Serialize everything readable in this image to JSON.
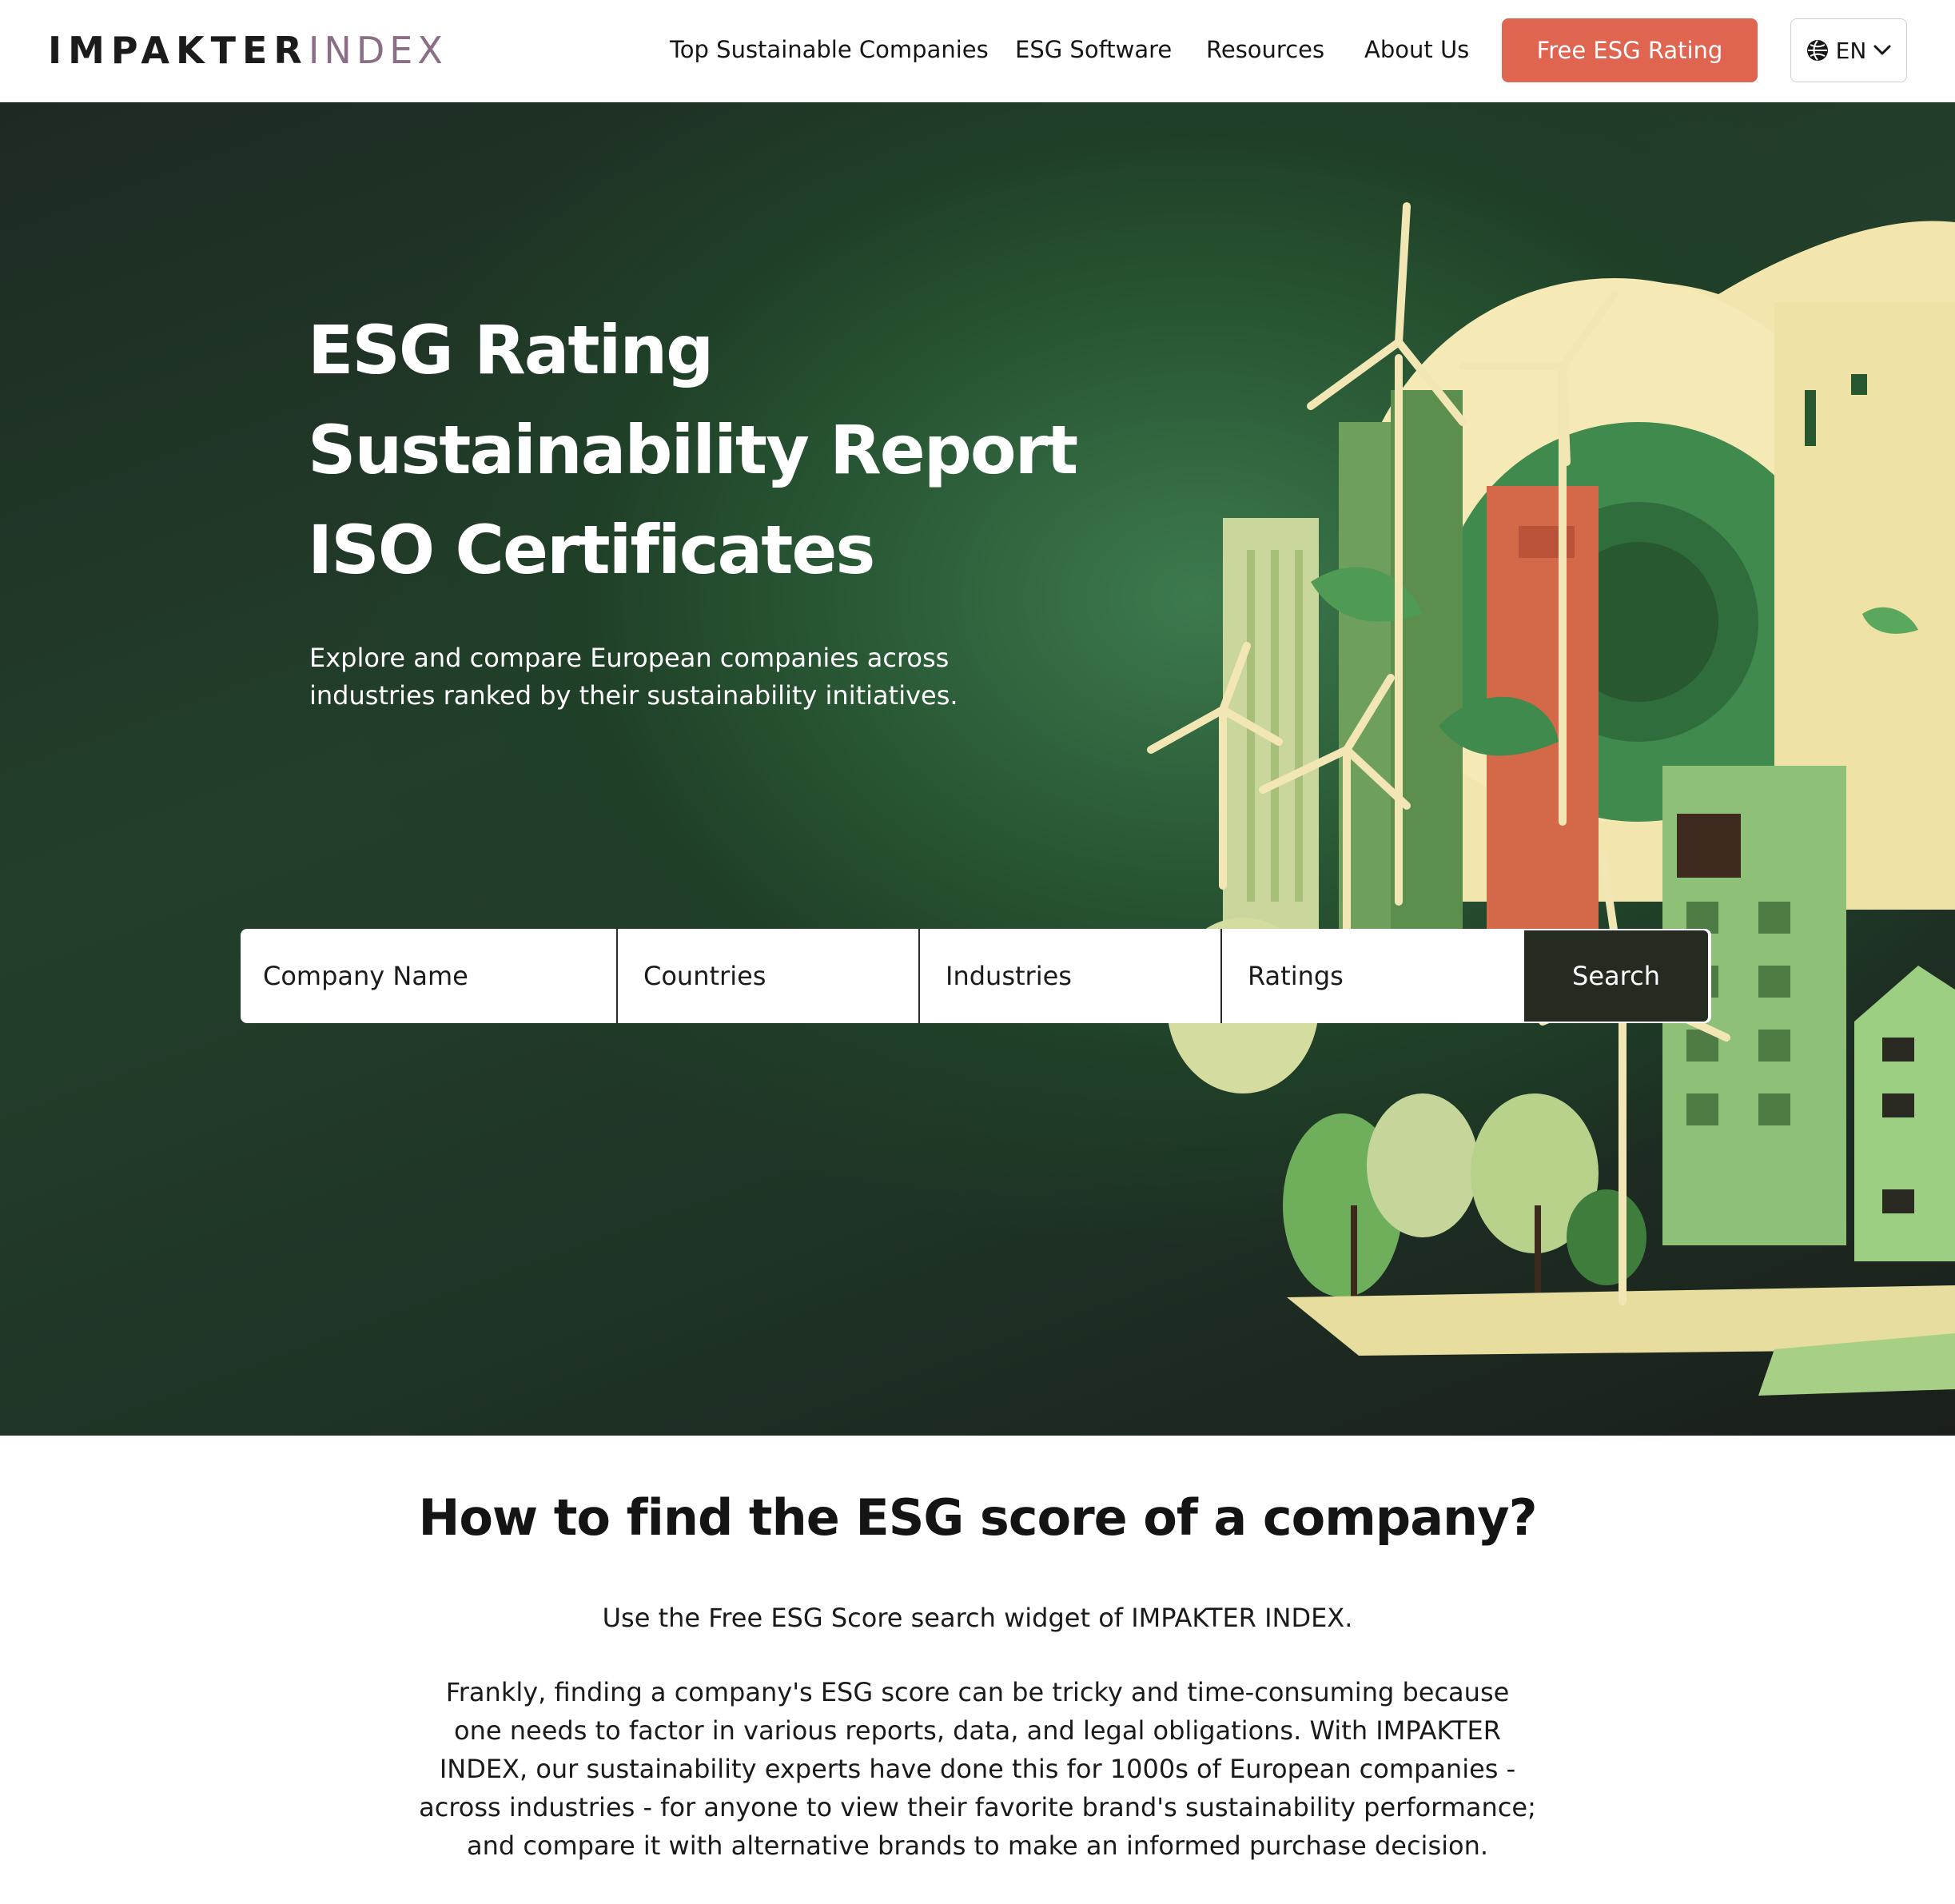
{
  "header": {
    "logo_primary": "IMPAKTER",
    "logo_secondary": "INDEX",
    "nav": [
      {
        "label": "Top Sustainable Companies"
      },
      {
        "label": "ESG Software"
      },
      {
        "label": "Resources"
      },
      {
        "label": "About Us"
      }
    ],
    "cta_label": "Free ESG Rating",
    "language": "EN",
    "cta_color": "#e06551"
  },
  "hero": {
    "titles": [
      "ESG Rating",
      "Sustainability Report",
      "ISO Certificates"
    ],
    "subtitle_lines": [
      "Explore and compare European companies across",
      "industries ranked by their sustainability initiatives."
    ],
    "search": {
      "company_placeholder": "Company Name",
      "countries_label": "Countries",
      "industries_label": "Industries",
      "ratings_label": "Ratings",
      "button_label": "Search"
    },
    "background_color": "#2a5a36"
  },
  "content": {
    "heading": "How to find the ESG score of a company?",
    "lead": "Use the Free ESG Score search widget of IMPAKTER INDEX.",
    "paragraph_lines": [
      "Frankly, finding a company's ESG score can be tricky and time-consuming because",
      "one needs to factor in various reports, data, and legal obligations. With IMPAKTER",
      "INDEX, our sustainability experts have done this for 1000s of European companies -",
      "across industries - for anyone to view their favorite brand's sustainability performance;",
      "and compare it with alternative brands to make an informed purchase decision."
    ]
  },
  "icons": {
    "language": "globe-icon",
    "dropdown": "chevron-down-icon"
  }
}
